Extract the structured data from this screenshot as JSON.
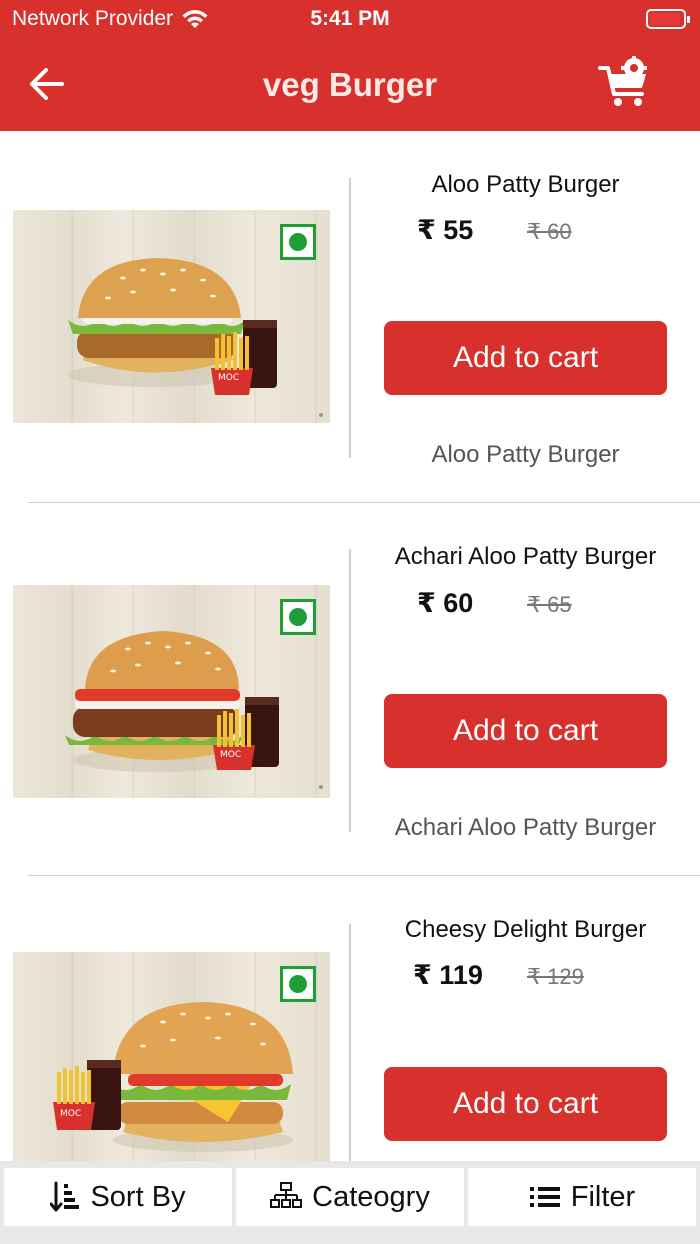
{
  "status_bar": {
    "provider": "Network Provider",
    "time": "5:41 PM"
  },
  "header": {
    "title": "veg Burger",
    "back_icon": "arrow-left-icon",
    "cart_icon": "cart-settings-icon"
  },
  "products": [
    {
      "name": "Aloo Patty Burger",
      "price": "₹ 55",
      "mrp": "₹ 60",
      "button": "Add to cart",
      "description": "Aloo Patty Burger",
      "veg": true
    },
    {
      "name": "Achari Aloo Patty Burger",
      "price": "₹ 60",
      "mrp": "₹ 65",
      "button": "Add to cart",
      "description": "Achari Aloo Patty Burger",
      "veg": true
    },
    {
      "name": "Cheesy Delight Burger",
      "price": "₹ 119",
      "mrp": "₹ 129",
      "button": "Add to cart",
      "description": "",
      "veg": true
    }
  ],
  "bottom_bar": {
    "sort_label": "Sort By",
    "category_label": "Cateogry",
    "filter_label": "Filter"
  },
  "colors": {
    "brand": "#d8302c",
    "veg_green": "#1f9e37"
  }
}
